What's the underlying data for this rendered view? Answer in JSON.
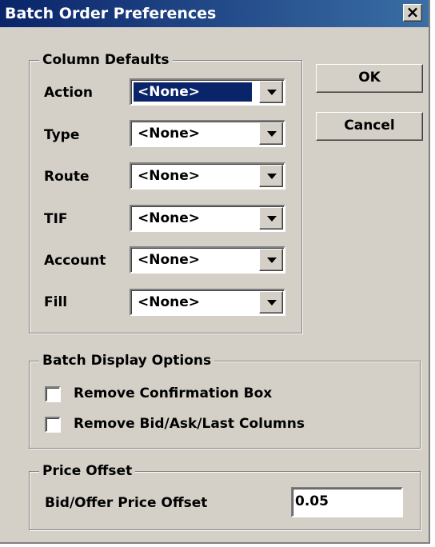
{
  "window": {
    "title": "Batch Order Preferences",
    "close_glyph": "×"
  },
  "column_defaults": {
    "legend": "Column Defaults",
    "fields": [
      {
        "label": "Action",
        "value": "<None>"
      },
      {
        "label": "Type",
        "value": "<None>"
      },
      {
        "label": "Route",
        "value": "<None>"
      },
      {
        "label": "TIF",
        "value": "<None>"
      },
      {
        "label": "Account",
        "value": "<None>"
      },
      {
        "label": "Fill",
        "value": "<None>"
      }
    ]
  },
  "buttons": {
    "ok": "OK",
    "cancel": "Cancel"
  },
  "display_options": {
    "legend": "Batch Display Options",
    "remove_confirmation": {
      "label": "Remove Confirmation Box",
      "checked": false
    },
    "remove_columns": {
      "label": "Remove Bid/Ask/Last Columns",
      "checked": false
    }
  },
  "price_offset": {
    "legend": "Price Offset",
    "label": "Bid/Offer Price Offset",
    "value": "0.05"
  },
  "colors": {
    "titlebar_start": "#0a246a",
    "titlebar_end": "#3a6ea5",
    "face": "#d4d0c8",
    "selection": "#0a246a"
  }
}
